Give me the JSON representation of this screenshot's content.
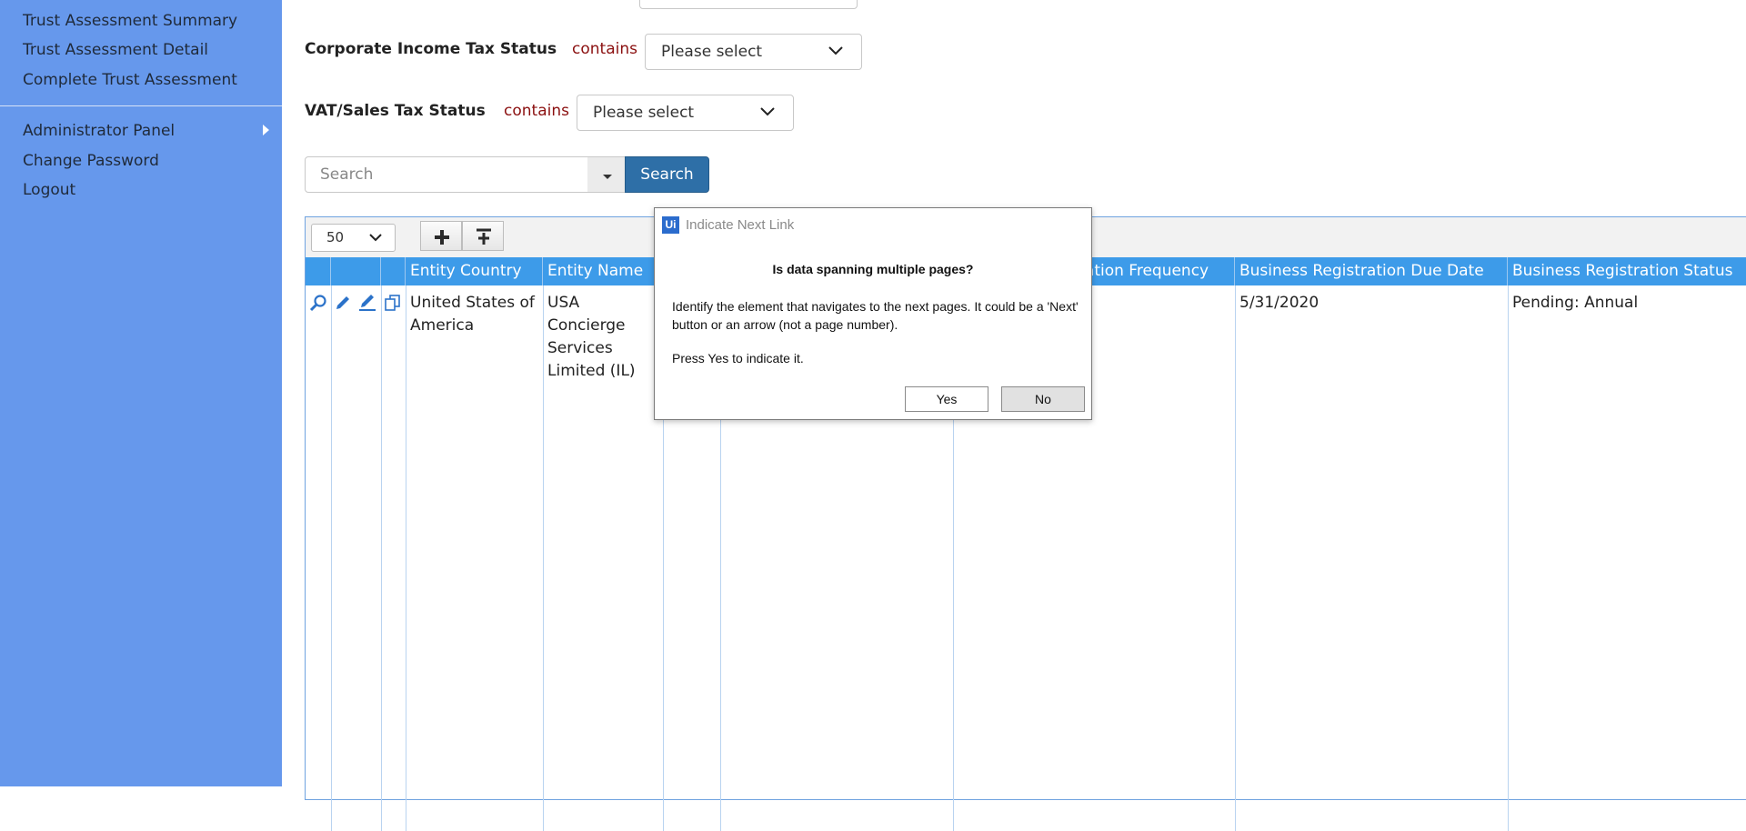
{
  "sidebar": {
    "items": [
      {
        "label": "Trust Assessment Summary"
      },
      {
        "label": "Trust Assessment Detail"
      },
      {
        "label": "Complete Trust Assessment"
      },
      {
        "label": "Administrator Panel"
      },
      {
        "label": "Change Password"
      },
      {
        "label": "Logout"
      }
    ]
  },
  "filters": {
    "corporate": {
      "label": "Corporate Income Tax Status",
      "operator": "contains",
      "value": "Please select"
    },
    "vat": {
      "label": "VAT/Sales Tax Status",
      "operator": "contains",
      "value": "Please select"
    }
  },
  "search": {
    "placeholder": "Search",
    "button_label": "Search"
  },
  "grid": {
    "page_size": "50",
    "columns": [
      {
        "label": ""
      },
      {
        "label": ""
      },
      {
        "label": ""
      },
      {
        "label": "Entity Country"
      },
      {
        "label": "Entity Name"
      },
      {
        "label": ""
      },
      {
        "label": ""
      },
      {
        "label": "Business Registration Frequency"
      },
      {
        "label": "Business Registration Due Date"
      },
      {
        "label": "Business Registration Status"
      }
    ],
    "rows": [
      {
        "entity_country": "United States of America",
        "entity_name": "USA Concierge Services Limited (IL)",
        "due_date": "5/31/2020",
        "status": "Pending: Annual"
      }
    ]
  },
  "dialog": {
    "logo": "Ui",
    "title": "Indicate Next Link",
    "question": "Is data spanning multiple pages?",
    "body": "Identify the element that navigates to the next pages. It could be a 'Next' button or an arrow (not a page number).",
    "press": "Press Yes to indicate it.",
    "yes_label": "Yes",
    "no_label": "No"
  }
}
